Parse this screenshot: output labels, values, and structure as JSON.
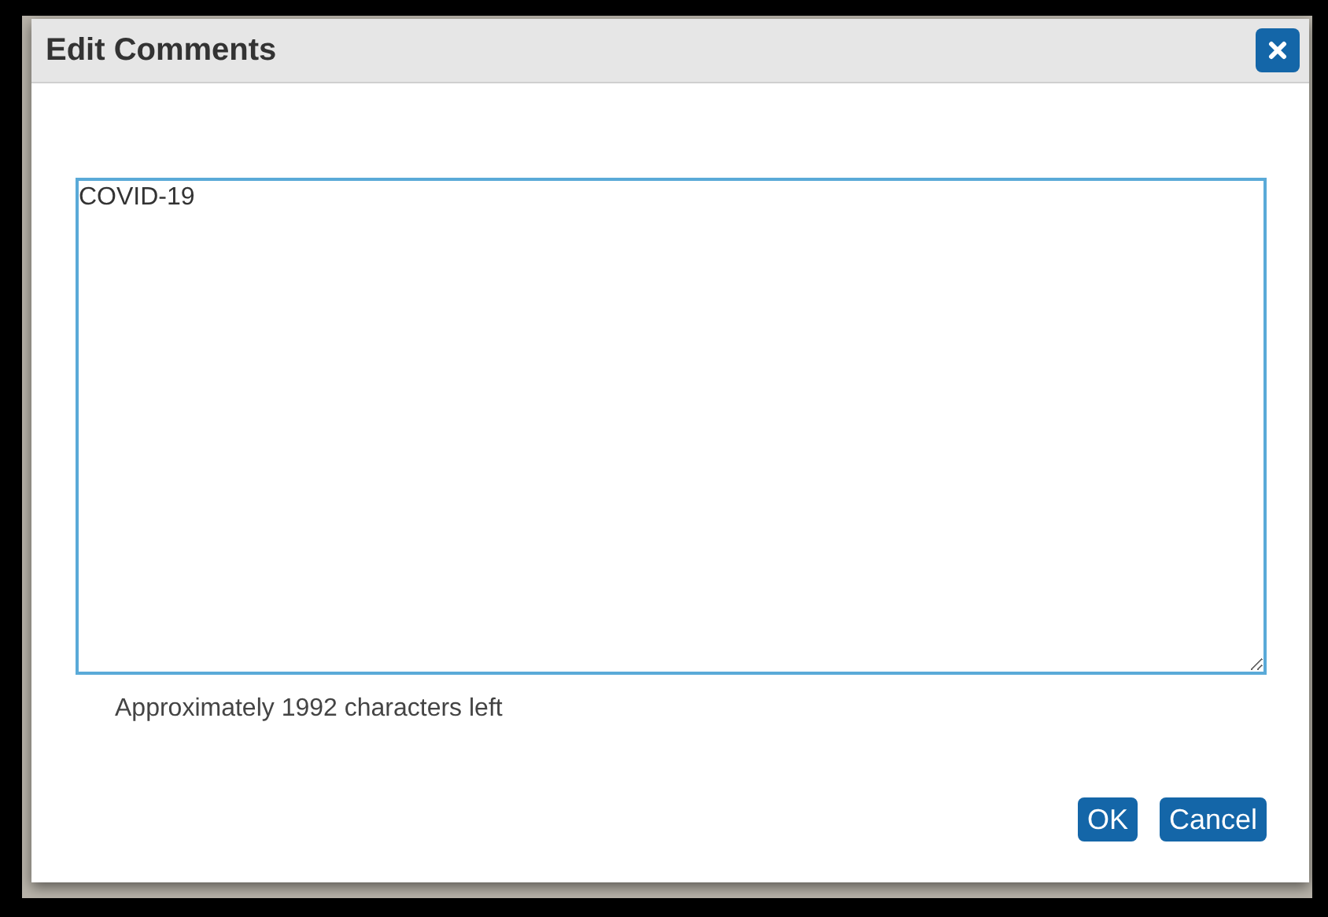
{
  "dialog": {
    "title": "Edit Comments",
    "comment": {
      "value": "COVID-19"
    },
    "hint": "Approximately 1992 characters left",
    "buttons": [
      "OK",
      "Cancel"
    ]
  }
}
